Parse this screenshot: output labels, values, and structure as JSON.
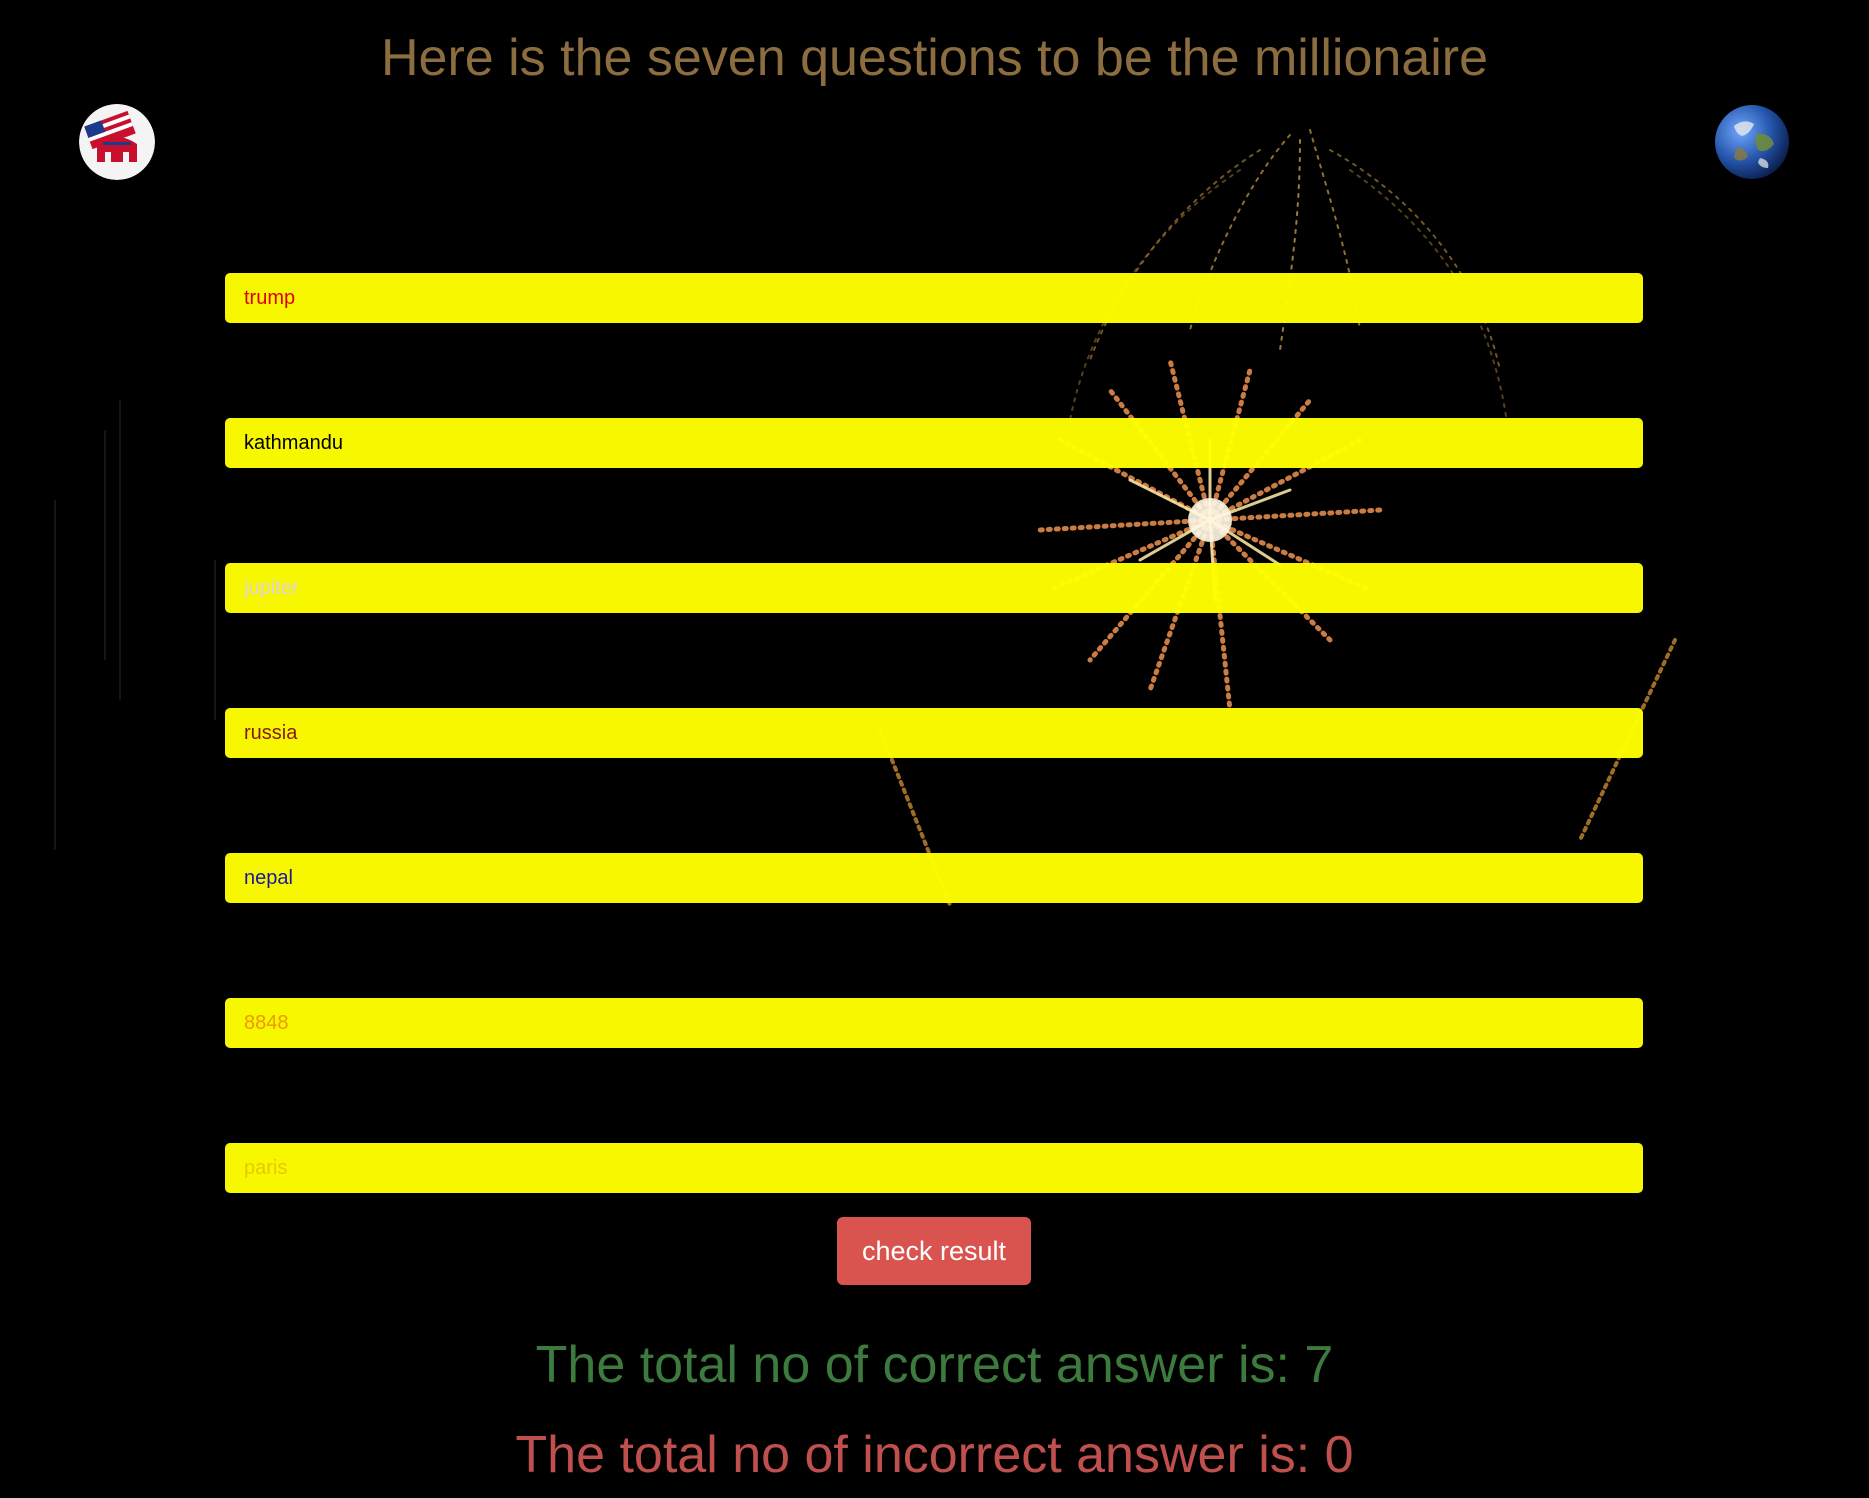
{
  "header": {
    "title": "Here is the seven questions to be the millionaire"
  },
  "icons": {
    "left": "american-flag-elephant-icon",
    "right": "earth-globe-icon"
  },
  "answers": [
    {
      "value": "trump",
      "color": "#e8000b"
    },
    {
      "value": "kathmandu",
      "color": "#000000"
    },
    {
      "value": "jupiter",
      "color": "#e9d9e6"
    },
    {
      "value": "russia",
      "color": "#8b1a1a"
    },
    {
      "value": "nepal",
      "color": "#1a1aa6"
    },
    {
      "value": "8848",
      "color": "#f5a000"
    },
    {
      "value": "paris",
      "color": "#f0d000"
    }
  ],
  "actions": {
    "check_label": "check result",
    "check_color": "#d9534f"
  },
  "results": {
    "correct_text": "The total no of correct answer is: 7",
    "correct_color": "#3d7a3d",
    "incorrect_text": "The total no of incorrect answer is: 0",
    "incorrect_color": "#c0504d"
  },
  "colors": {
    "background": "#000000",
    "field_background": "#ffff00",
    "title_color": "#8c6d3f"
  }
}
